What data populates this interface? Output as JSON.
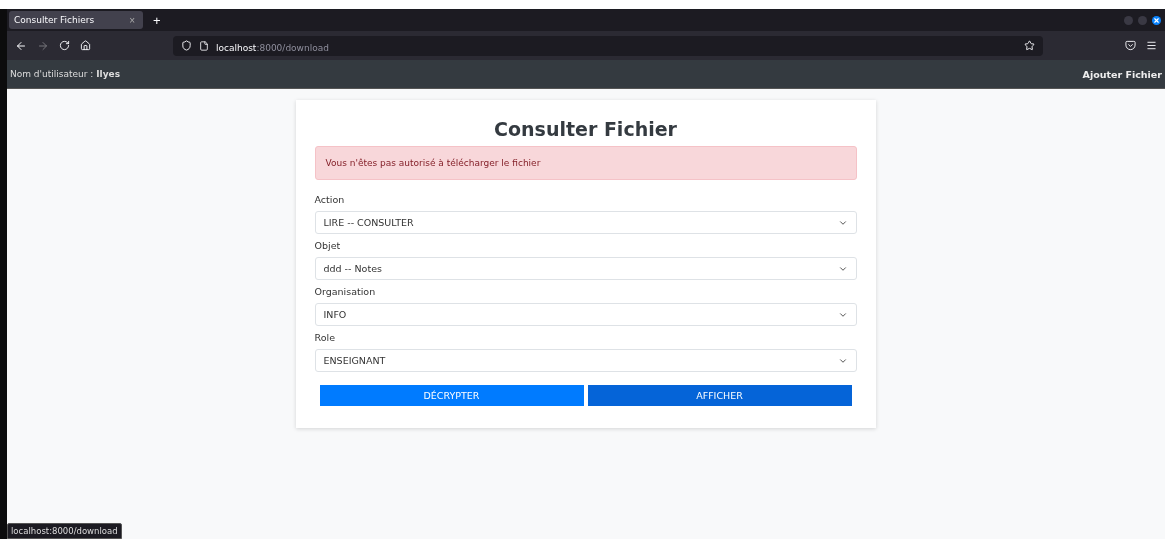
{
  "browser": {
    "tab": {
      "title": "Consulter Fichiers",
      "close": "×"
    },
    "new_tab": "+",
    "url": {
      "host": "localhost",
      "path": ":8000/download"
    },
    "status_url": "localhost:8000/download"
  },
  "navbar": {
    "user_label": "Nom d'utilisateur :",
    "user_name": "Ilyes",
    "link": "Ajouter Fichier"
  },
  "card": {
    "title": "Consulter Fichier",
    "alert": "Vous n'êtes pas autorisé à télécharger le fichier",
    "fields": [
      {
        "label": "Action",
        "value": "LIRE -- CONSULTER"
      },
      {
        "label": "Objet",
        "value": "ddd -- Notes"
      },
      {
        "label": "Organisation",
        "value": "INFO"
      },
      {
        "label": "Role",
        "value": "ENSEIGNANT"
      }
    ],
    "buttons": [
      {
        "label": "DÉCRYPTER",
        "hovered": false
      },
      {
        "label": "AFFICHER",
        "hovered": true
      }
    ]
  }
}
